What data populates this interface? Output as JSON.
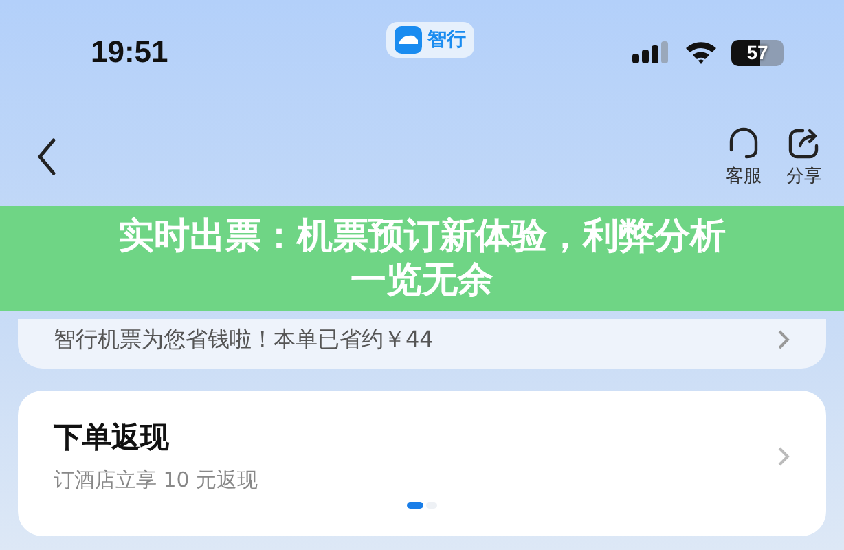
{
  "status_bar": {
    "time": "19:51",
    "app_badge": "智行",
    "battery": "57"
  },
  "nav": {
    "actions": [
      {
        "label": "客服",
        "kind": "headset"
      },
      {
        "label": "分享",
        "kind": "share"
      }
    ]
  },
  "ticket_card": {
    "savings": "智行机票为您省钱啦！本单已省约￥44"
  },
  "cashback_card": {
    "title": "下单返现",
    "subtitle": "订酒店立享 10 元返现"
  },
  "pager": [
    {
      "selected": true
    },
    {
      "selected": false
    }
  ],
  "banner": {
    "title": "实时出票：机票预订新体验，利弊分析一览无余"
  }
}
